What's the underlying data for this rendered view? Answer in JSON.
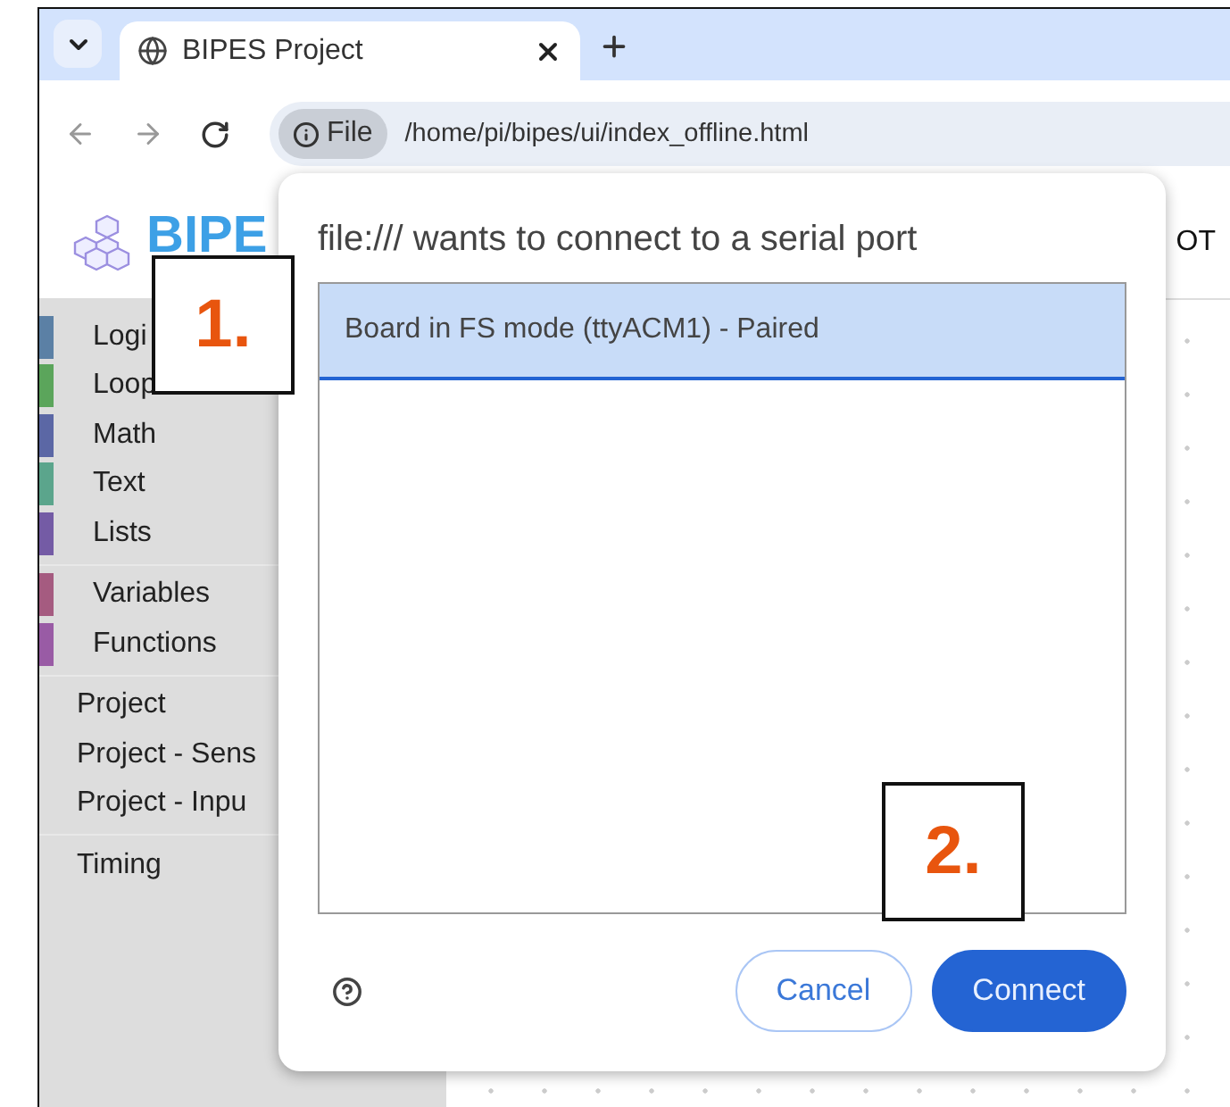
{
  "browser": {
    "tabs": [
      {
        "title": "BIPES Project",
        "selected": true
      }
    ],
    "address": {
      "chip": "File",
      "url": "/home/pi/bipes/ui/index_offline.html"
    }
  },
  "page": {
    "logo": "BIPE",
    "header_right": "OT",
    "sidebar": {
      "groups": [
        {
          "items": [
            {
              "label": "Logi",
              "color": "#5b80a5"
            },
            {
              "label": "Loop",
              "color": "#5ba55b"
            },
            {
              "label": "Math",
              "color": "#5b67a5"
            },
            {
              "label": "Text",
              "color": "#5ba58c"
            },
            {
              "label": "Lists",
              "color": "#745ba5"
            }
          ]
        },
        {
          "items": [
            {
              "label": "Variables",
              "color": "#a55b80"
            },
            {
              "label": "Functions",
              "color": "#995ba5"
            }
          ]
        },
        {
          "items": [
            {
              "label": "Project"
            },
            {
              "label": "Project - Sens"
            },
            {
              "label": "Project - Inpu"
            }
          ]
        },
        {
          "items": [
            {
              "label": "Timing"
            }
          ]
        }
      ]
    }
  },
  "dialog": {
    "title": "file:/// wants to connect to a serial port",
    "ports": [
      {
        "label": "Board in FS mode (ttyACM1) - Paired",
        "selected": true
      }
    ],
    "buttons": [
      {
        "label": "Cancel",
        "kind": "secondary"
      },
      {
        "label": "Connect",
        "kind": "primary"
      }
    ]
  },
  "annotations": [
    {
      "label": "1."
    },
    {
      "label": "2."
    }
  ]
}
